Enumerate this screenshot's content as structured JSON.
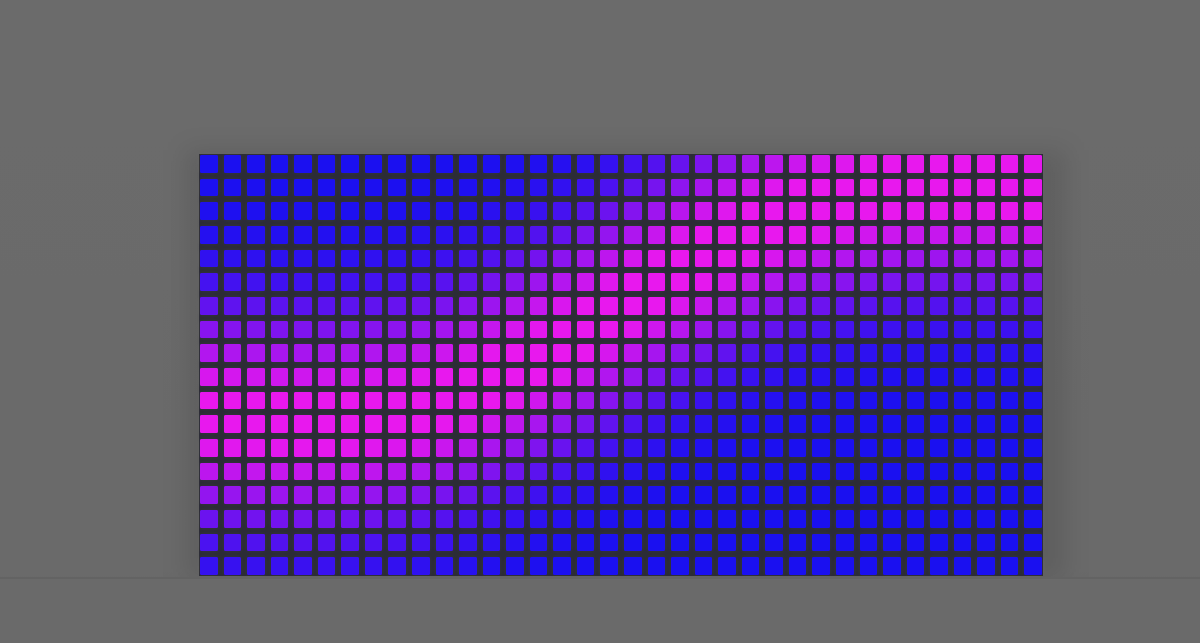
{
  "scene": {
    "background_color": "#6a6a6a",
    "panel_frame_color": "#2c2c36"
  },
  "led_panel": {
    "columns": 36,
    "rows": 18,
    "color_low": "#1a10f0",
    "color_high": "#e818ee"
  }
}
